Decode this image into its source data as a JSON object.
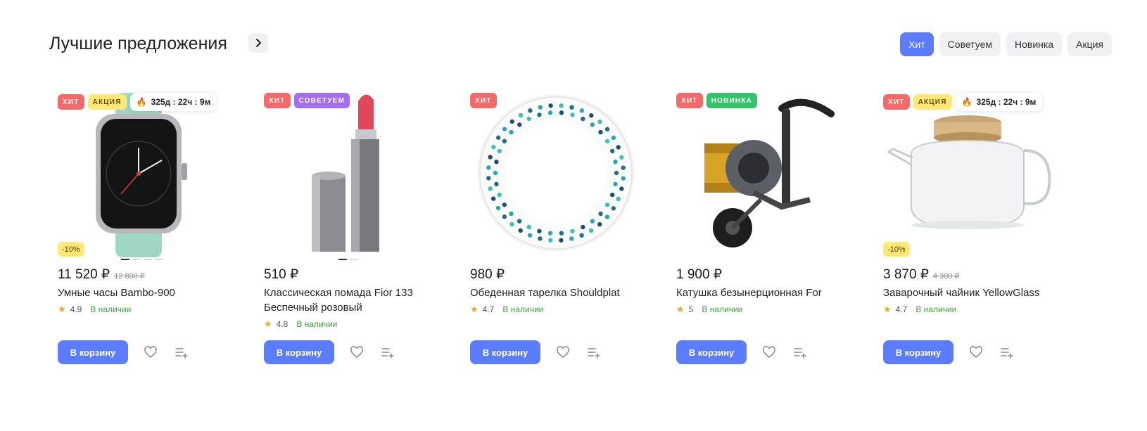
{
  "section": {
    "title": "Лучшие предложения",
    "arrow_icon": "chevron-right-icon",
    "filters": [
      "Хит",
      "Советуем",
      "Новинка",
      "Акция"
    ],
    "active_filter": "Хит"
  },
  "colors": {
    "accent": "#5b7cff",
    "hit": "#f46a6a",
    "sale": "#ffe878",
    "recommend": "#a46ef0",
    "new": "#33c36a",
    "in_stock": "#3aa53a"
  },
  "cart_label": "В корзину",
  "products": [
    {
      "badges": [
        "ХИТ",
        "АКЦИЯ"
      ],
      "timer": "325д : 22ч : 9м",
      "discount": "-10%",
      "price": "11 520 ₽",
      "old_price": "12 800 ₽",
      "name": "Умные часы Bambo-900",
      "rating": "4.9",
      "stock": "В наличии",
      "image": "smartwatch"
    },
    {
      "badges": [
        "ХИТ",
        "СОВЕТУЕМ"
      ],
      "price": "510 ₽",
      "name": "Классическая помада Fior 133 Беспечный розовый",
      "rating": "4.8",
      "stock": "В наличии",
      "image": "lipstick"
    },
    {
      "badges": [
        "ХИТ"
      ],
      "price": "980 ₽",
      "name": "Обеденная тарелка Shouldplat",
      "rating": "4.7",
      "stock": "В наличии",
      "image": "plate"
    },
    {
      "badges": [
        "ХИТ",
        "НОВИНКА"
      ],
      "price": "1 900 ₽",
      "name": "Катушка безынерционная For",
      "rating": "5",
      "stock": "В наличии",
      "image": "fishing-reel"
    },
    {
      "badges": [
        "ХИТ",
        "АКЦИЯ"
      ],
      "timer": "325д : 22ч : 9м",
      "discount": "-10%",
      "price": "3 870 ₽",
      "old_price": "4 300 ₽",
      "name": "Заварочный чайник YellowGlass",
      "rating": "4.7",
      "stock": "В наличии",
      "image": "teapot"
    }
  ]
}
